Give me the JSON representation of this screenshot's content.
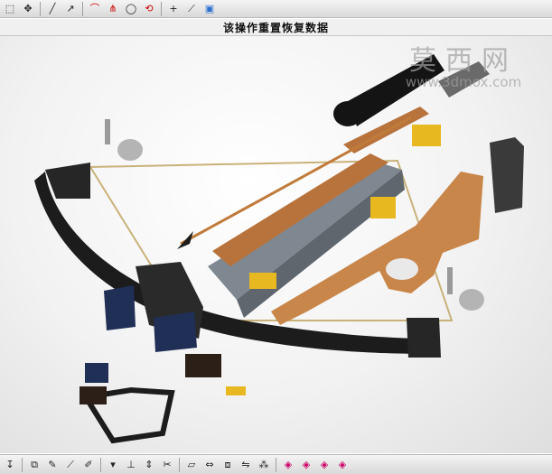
{
  "dialog_title": "该操作重置恢复数据",
  "watermark": {
    "brand_cn": "莫西网",
    "url": "www.3dmox.com"
  },
  "top_toolbar": {
    "icons": [
      "select-icon",
      "snap-icon",
      "line-icon",
      "probe-icon",
      "arc-icon",
      "branch-icon",
      "circle-icon",
      "rotate-icon",
      "point-icon",
      "tangent-icon",
      "cube-icon"
    ]
  },
  "bottom_toolbar": {
    "icons": [
      "arrow-icon",
      "layer-icon",
      "pen-icon",
      "vector-icon",
      "sketch-icon",
      "arrow-dropdown-icon",
      "constraint-icon",
      "dimension-icon",
      "trim-icon",
      "plane-icon",
      "align-icon",
      "offset-icon",
      "mirror-icon",
      "pattern-icon",
      "view-front-icon",
      "view-top-icon",
      "view-right-icon",
      "view-iso-icon"
    ]
  },
  "colors": {
    "bow_limb": "#1c1c1c",
    "stock": "#c8864a",
    "rail": "#b8733c",
    "metal": "#7f8790",
    "gold": "#e8b820",
    "string": "#c9b27a",
    "scope": "#141414",
    "navy": "#1f2f55"
  }
}
